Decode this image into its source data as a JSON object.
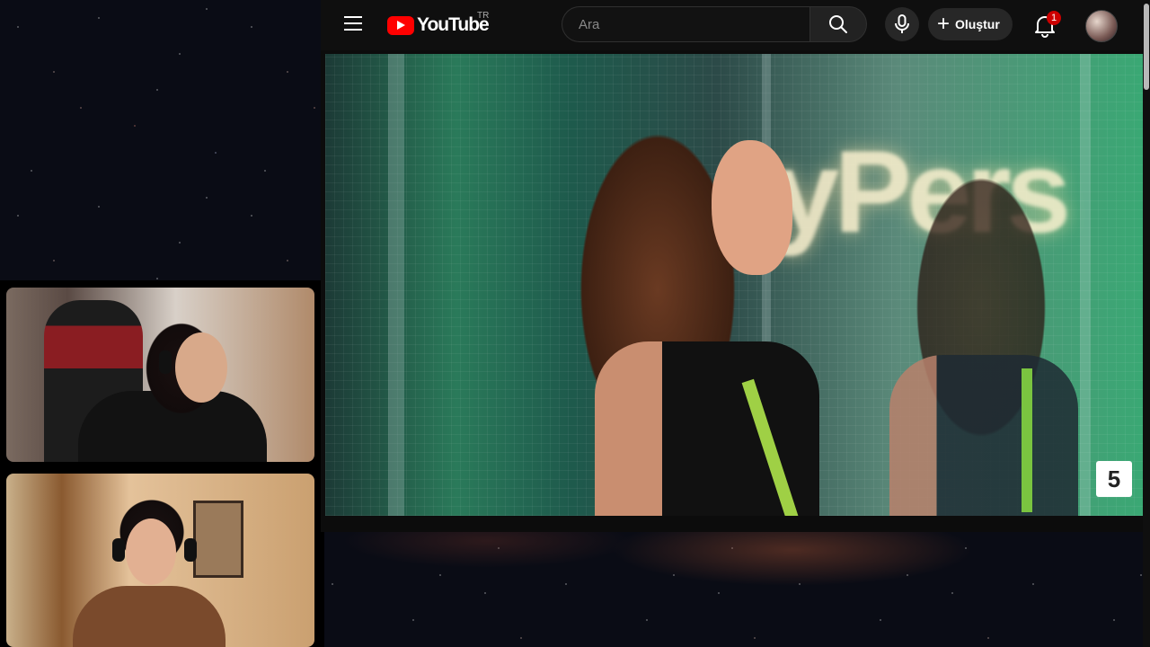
{
  "header": {
    "logo_text": "YouTube",
    "country_code": "TR",
    "search_placeholder": "Ara",
    "create_label": "Oluştur",
    "notification_count": "1"
  },
  "video": {
    "channel_badge": "5",
    "overlay_text": "yPers"
  },
  "colors": {
    "header_bg": "#0f0f0f",
    "brand_red": "#ff0000",
    "badge_red": "#cc0000"
  },
  "icons": [
    "menu-icon",
    "youtube-logo-icon",
    "search-icon",
    "mic-icon",
    "plus-icon",
    "bell-icon",
    "avatar"
  ]
}
